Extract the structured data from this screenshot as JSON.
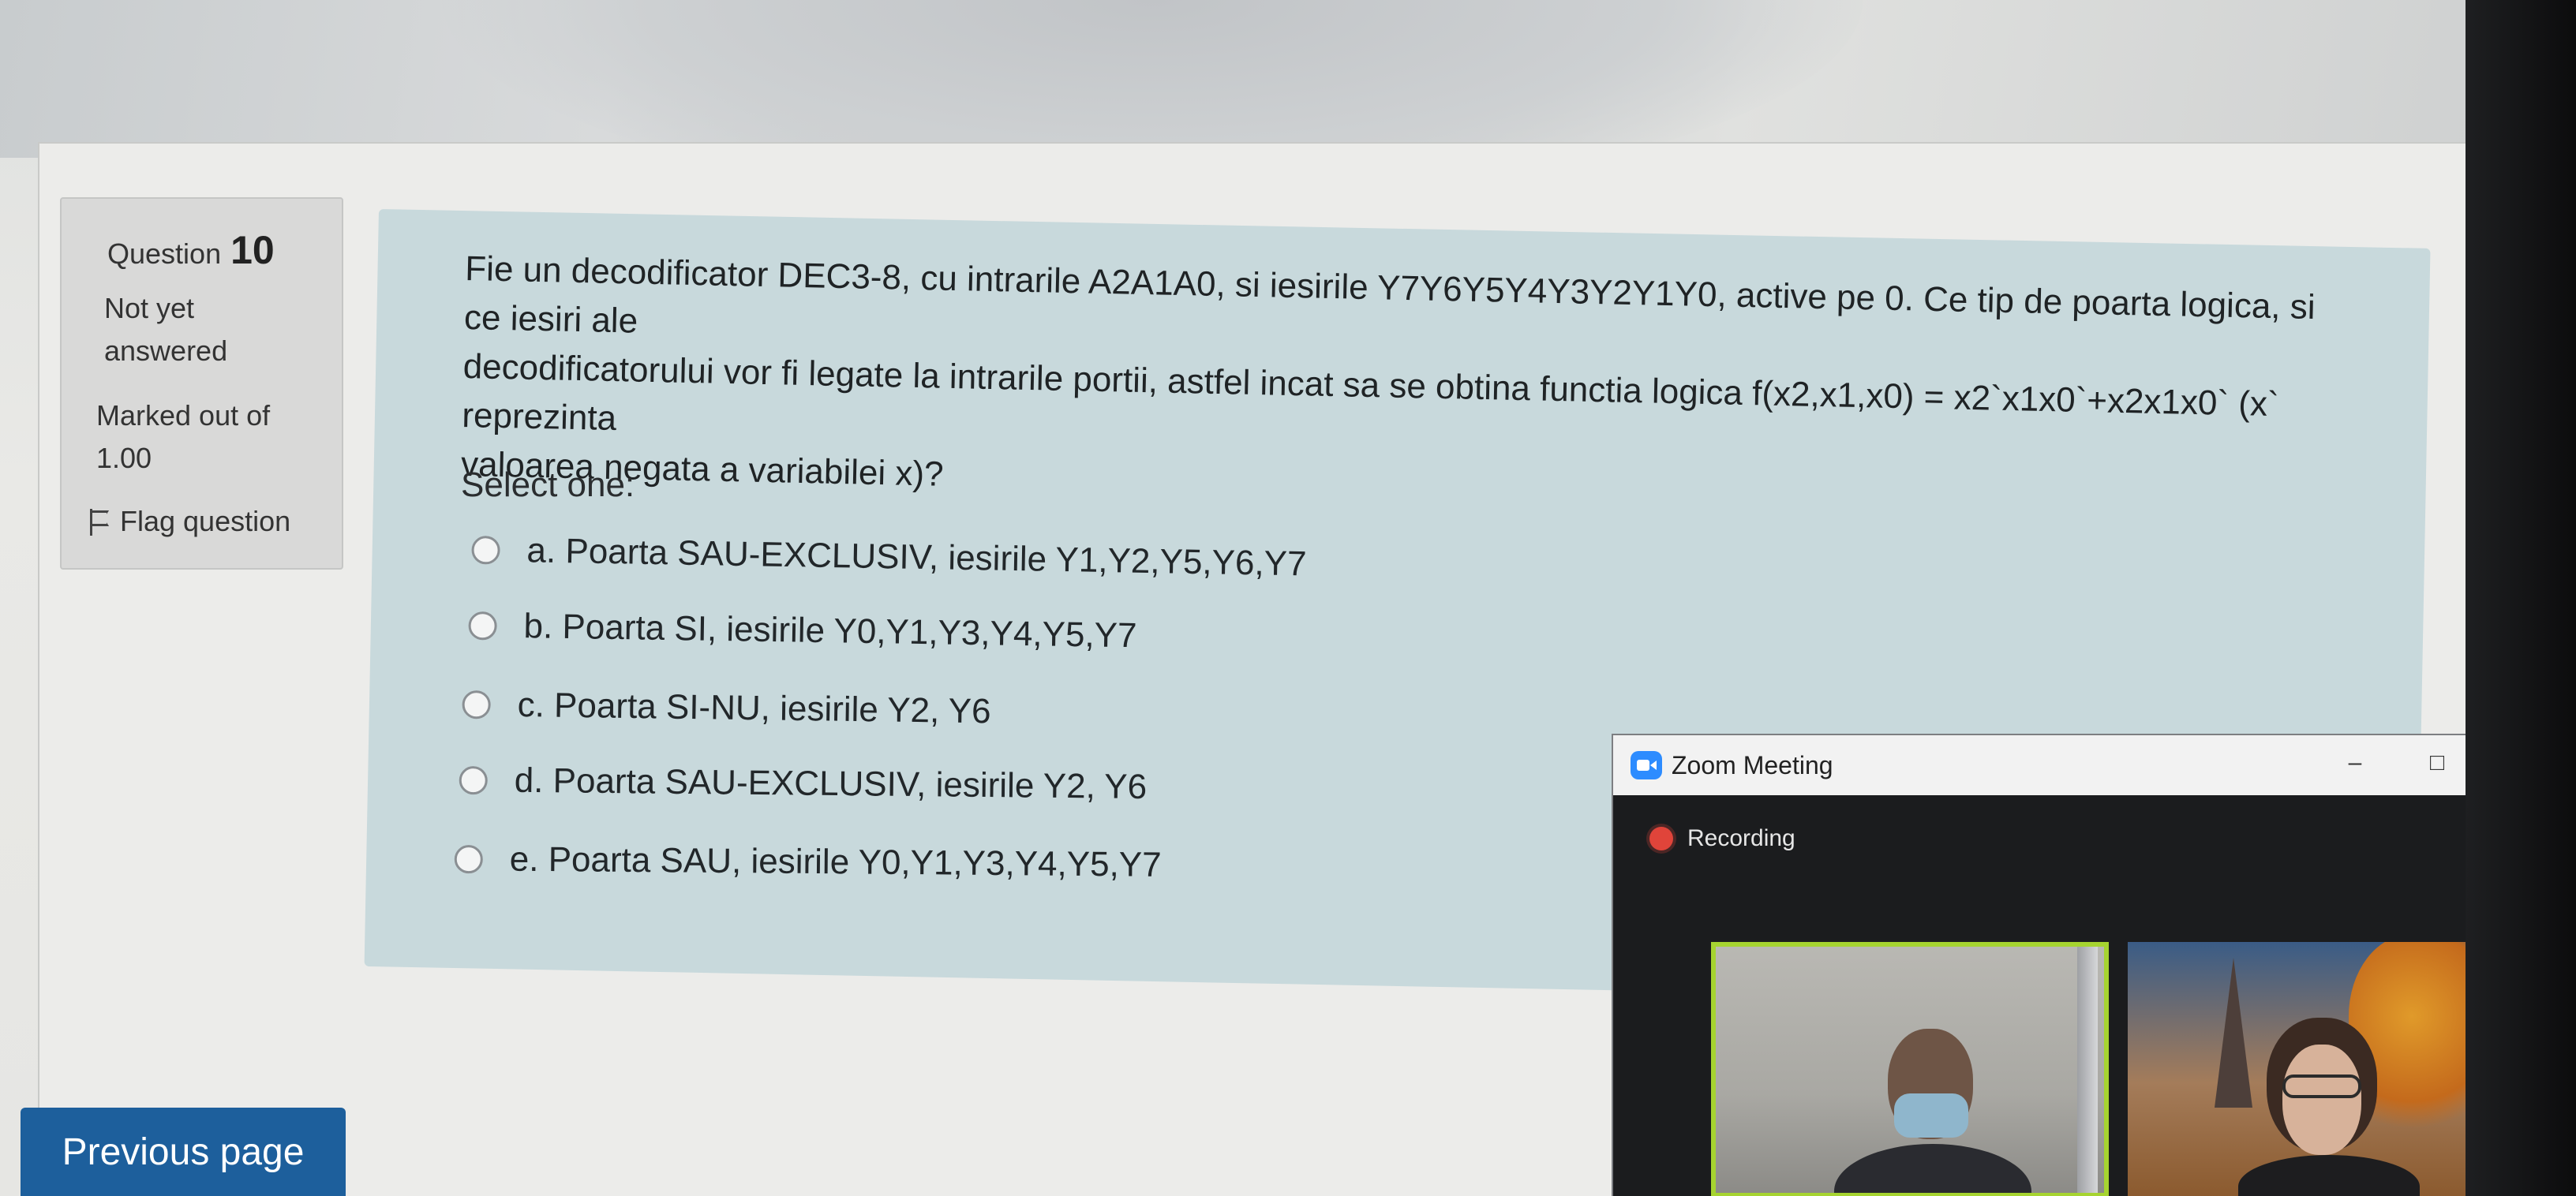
{
  "question": {
    "label": "Question",
    "number": "10",
    "state_line1": "Not yet",
    "state_line2": "answered",
    "marked_line1": "Marked out of",
    "marked_line2": "1.00",
    "flag_label": "Flag question",
    "text_line1": "Fie un decodificator DEC3-8, cu intrarile A2A1A0, si iesirile Y7Y6Y5Y4Y3Y2Y1Y0, active pe 0. Ce tip de poarta logica, si ce iesiri ale",
    "text_line2": "decodificatorului vor fi legate la intrarile portii, astfel incat sa se obtina functia logica f(x2,x1,x0) = x2`x1x0`+x2x1x0` (x` reprezinta",
    "text_line3": "valoarea negata a variabilei x)?",
    "select_prompt": "Select one:",
    "options": [
      {
        "label": "a. Poarta SAU-EXCLUSIV, iesirile Y1,Y2,Y5,Y6,Y7",
        "selected": false
      },
      {
        "label": "b. Poarta SI, iesirile Y0,Y1,Y3,Y4,Y5,Y7",
        "selected": false
      },
      {
        "label": "c. Poarta SI-NU, iesirile Y2, Y6",
        "selected": false
      },
      {
        "label": "d. Poarta SAU-EXCLUSIV, iesirile Y2, Y6",
        "selected": false
      },
      {
        "label": "e. Poarta SAU, iesirile Y0,Y1,Y3,Y4,Y5,Y7",
        "selected": false
      }
    ]
  },
  "navigation": {
    "previous_label": "Previous page"
  },
  "zoom": {
    "title": "Zoom Meeting",
    "minimize": "–",
    "maximize": "□",
    "close": "×",
    "recording_label": "Recording",
    "colors": {
      "active_speaker_border": "#a6d430",
      "recording_dot": "#e0443a",
      "logo": "#2d8cff"
    }
  },
  "colors": {
    "content_bg": "#c8d9dc",
    "info_bg": "#d9d9d8",
    "primary_button": "#1d5f9c"
  }
}
